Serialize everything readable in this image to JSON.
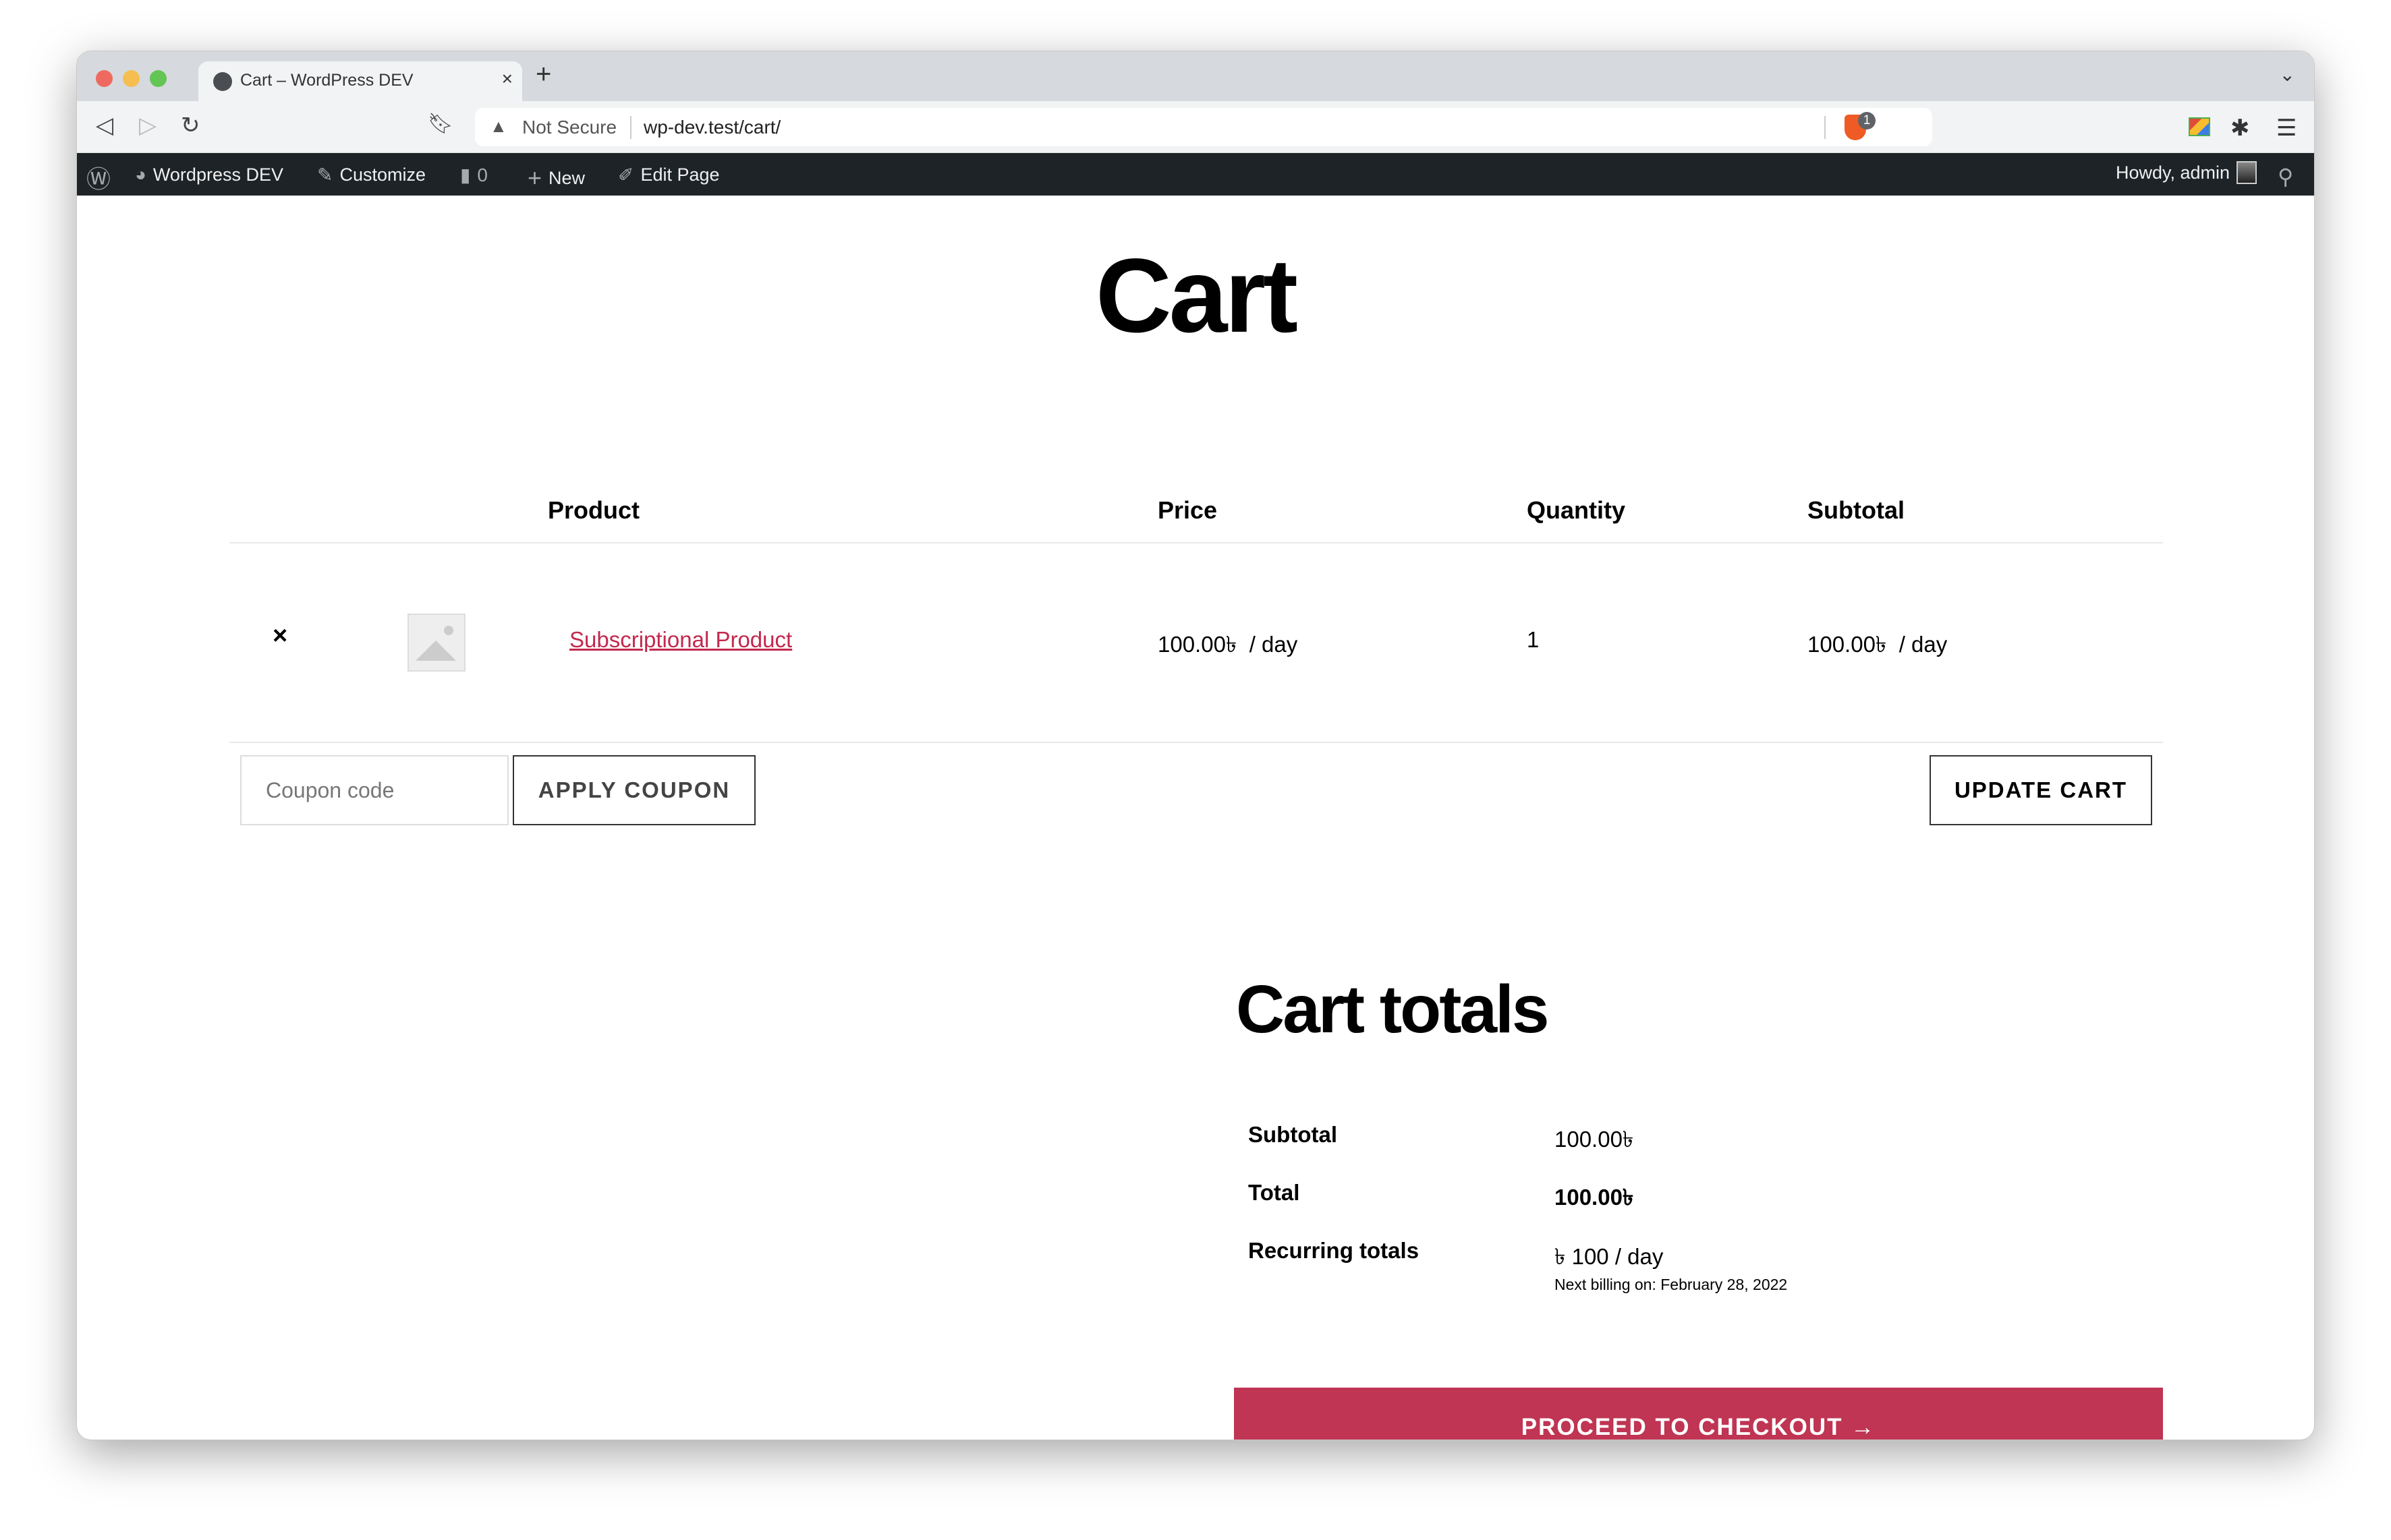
{
  "browser": {
    "tab_title": "Cart – WordPress DEV",
    "new_tab": "+",
    "security_label": "Not Secure",
    "url": "wp-dev.test/cart/",
    "shield_badge": "1"
  },
  "admin_bar": {
    "site_name": "Wordpress DEV",
    "customize": "Customize",
    "comments_count": "0",
    "new": "New",
    "edit_page": "Edit Page",
    "howdy": "Howdy, admin"
  },
  "page": {
    "title": "Cart",
    "table": {
      "headers": [
        "Product",
        "Price",
        "Quantity",
        "Subtotal"
      ],
      "rows": [
        {
          "remove": "×",
          "product": "Subscriptional Product",
          "price": "100.00৳  / day",
          "quantity": "1",
          "subtotal": "100.00৳  / day"
        }
      ]
    },
    "coupon_placeholder": "Coupon code",
    "apply_coupon": "APPLY COUPON",
    "update_cart": "UPDATE CART",
    "totals": {
      "title": "Cart totals",
      "subtotal_label": "Subtotal",
      "subtotal_value": "100.00৳",
      "total_label": "Total",
      "total_value": "100.00৳",
      "recurring_label": "Recurring totals",
      "recurring_value": "৳ 100 / day",
      "next_billing": "Next billing on: February 28, 2022"
    },
    "checkout": "PROCEED TO CHECKOUT →"
  },
  "colors": {
    "accent": "#bf3553",
    "link": "#c3284d",
    "admin_bar": "#1d2327"
  }
}
